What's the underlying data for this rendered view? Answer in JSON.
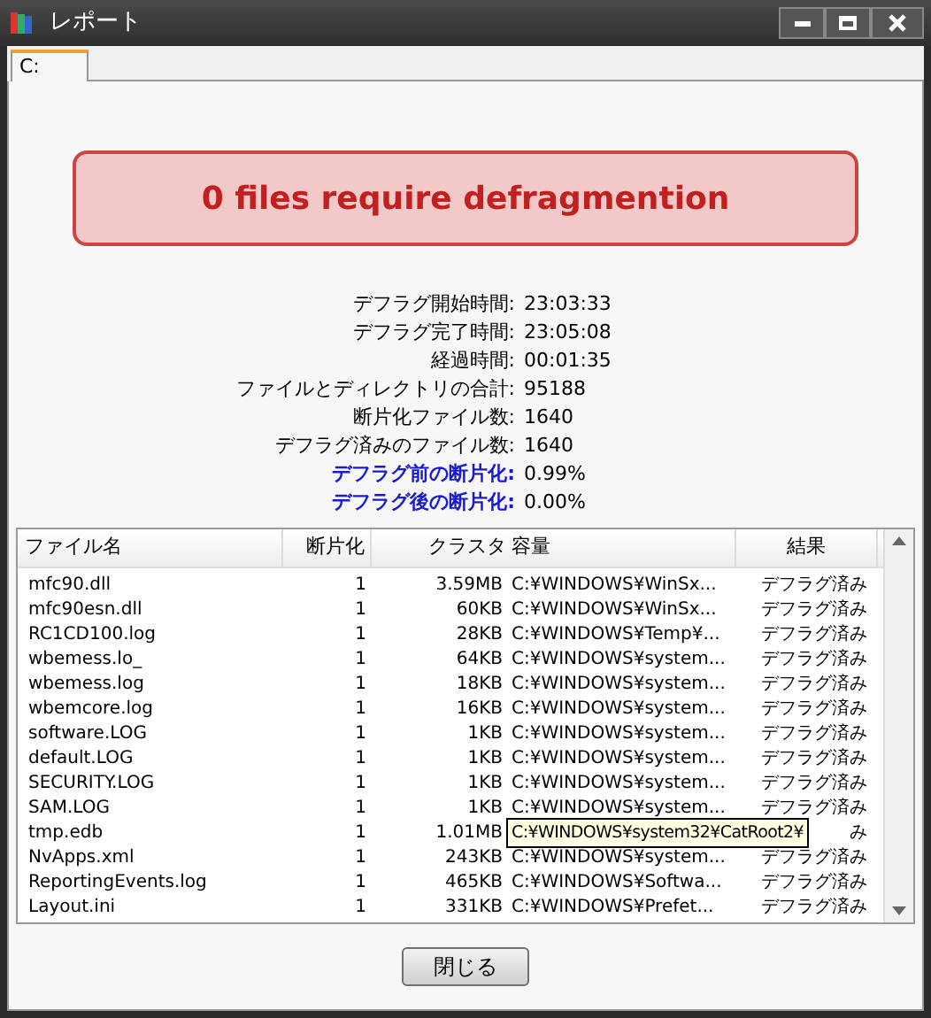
{
  "window": {
    "title": "レポート"
  },
  "tabs": [
    {
      "label": "C:",
      "selected": true
    }
  ],
  "banner": "0 files require defragmention",
  "stats": [
    {
      "label": "デフラグ開始時間:",
      "value": "23:03:33",
      "emphasis": false
    },
    {
      "label": "デフラグ完了時間:",
      "value": "23:05:08",
      "emphasis": false
    },
    {
      "label": "経過時間:",
      "value": "00:01:35",
      "emphasis": false
    },
    {
      "label": "ファイルとディレクトリの合計:",
      "value": "95188",
      "emphasis": false
    },
    {
      "label": "断片化ファイル数:",
      "value": "1640",
      "emphasis": false
    },
    {
      "label": "デフラグ済みのファイル数:",
      "value": "1640",
      "emphasis": false
    },
    {
      "label": "デフラグ前の断片化:",
      "value": "0.99%",
      "emphasis": true
    },
    {
      "label": "デフラグ後の断片化:",
      "value": "0.00%",
      "emphasis": true
    }
  ],
  "table": {
    "columns": [
      "ファイル名",
      "断片化",
      "クラスタ",
      "容量",
      "結果"
    ],
    "rows": [
      [
        "mfc90.dll",
        "1",
        "3.59MB",
        "C:¥WINDOWS¥WinSx...",
        "デフラグ済み"
      ],
      [
        "mfc90esn.dll",
        "1",
        "60KB",
        "C:¥WINDOWS¥WinSx...",
        "デフラグ済み"
      ],
      [
        "RC1CD100.log",
        "1",
        "28KB",
        "C:¥WINDOWS¥Temp¥...",
        "デフラグ済み"
      ],
      [
        "wbemess.lo_",
        "1",
        "64KB",
        "C:¥WINDOWS¥system...",
        "デフラグ済み"
      ],
      [
        "wbemess.log",
        "1",
        "18KB",
        "C:¥WINDOWS¥system...",
        "デフラグ済み"
      ],
      [
        "wbemcore.log",
        "1",
        "16KB",
        "C:¥WINDOWS¥system...",
        "デフラグ済み"
      ],
      [
        "software.LOG",
        "1",
        "1KB",
        "C:¥WINDOWS¥system...",
        "デフラグ済み"
      ],
      [
        "default.LOG",
        "1",
        "1KB",
        "C:¥WINDOWS¥system...",
        "デフラグ済み"
      ],
      [
        "SECURITY.LOG",
        "1",
        "1KB",
        "C:¥WINDOWS¥system...",
        "デフラグ済み"
      ],
      [
        "SAM.LOG",
        "1",
        "1KB",
        "C:¥WINDOWS¥system...",
        "デフラグ済み"
      ],
      {
        "cells": [
          "tmp.edb",
          "1",
          "1.01MB",
          "",
          "み"
        ],
        "tooltip": "C:¥WINDOWS¥system32¥CatRoot2¥"
      },
      [
        "NvApps.xml",
        "1",
        "243KB",
        "C:¥WINDOWS¥system...",
        "デフラグ済み"
      ],
      [
        "ReportingEvents.log",
        "1",
        "465KB",
        "C:¥WINDOWS¥Softwa...",
        "デフラグ済み"
      ],
      [
        "Layout.ini",
        "1",
        "331KB",
        "C:¥WINDOWS¥Prefet...",
        "デフラグ済み"
      ]
    ]
  },
  "buttons": [
    "閉じる"
  ]
}
